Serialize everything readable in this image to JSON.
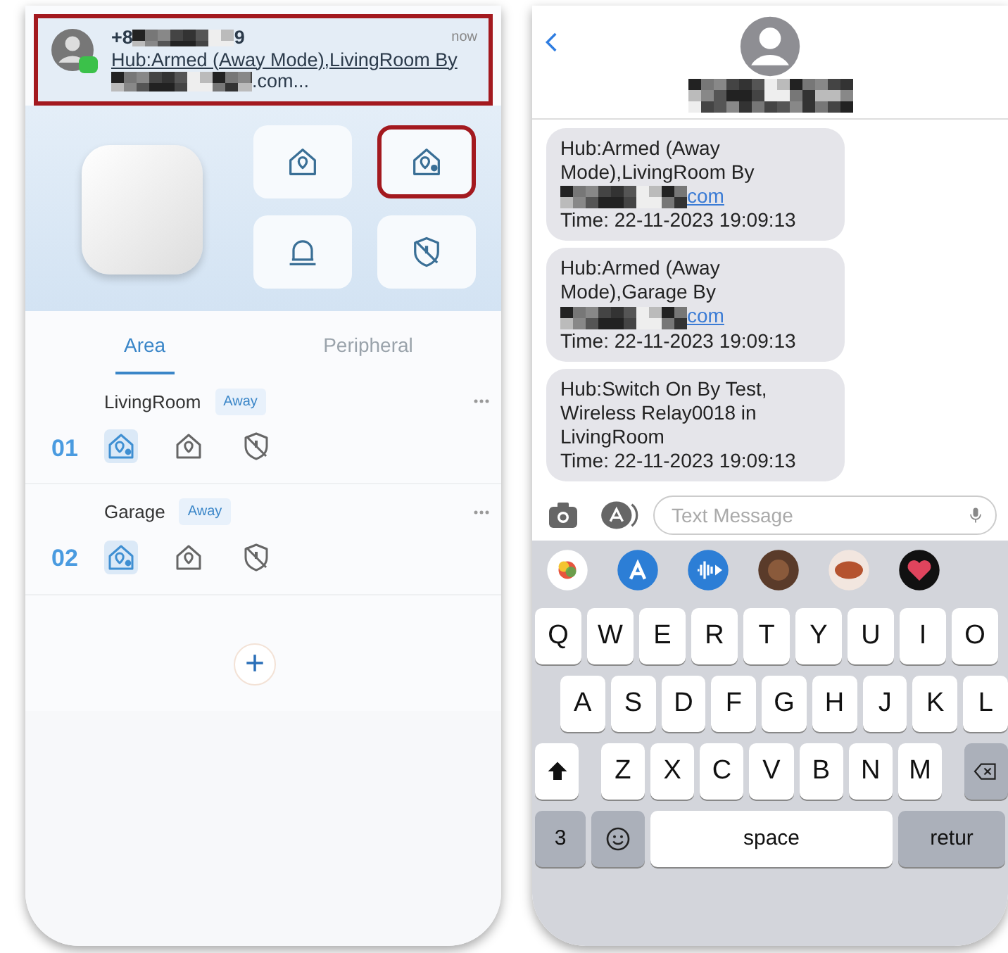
{
  "notification": {
    "sender_prefix": "+8",
    "sender_suffix": "9",
    "time": "now",
    "line_1": "Hub:Armed (Away Mode),LivingRoom By",
    "line_2_suffix": ".com...",
    "highlighted": true
  },
  "mode_buttons": [
    {
      "kind": "home",
      "highlighted": false
    },
    {
      "kind": "away",
      "highlighted": true
    },
    {
      "kind": "alarm",
      "highlighted": false
    },
    {
      "kind": "disarm",
      "highlighted": false
    }
  ],
  "tabs": [
    {
      "label": "Area",
      "selected": true
    },
    {
      "label": "Peripheral",
      "selected": false
    }
  ],
  "areas": [
    {
      "number": "01",
      "name": "LivingRoom",
      "badge": "Away",
      "modes": [
        {
          "kind": "away",
          "selected": true
        },
        {
          "kind": "home",
          "selected": false
        },
        {
          "kind": "disarm",
          "selected": false
        }
      ]
    },
    {
      "number": "02",
      "name": "Garage",
      "badge": "Away",
      "modes": [
        {
          "kind": "away",
          "selected": true
        },
        {
          "kind": "home",
          "selected": false
        },
        {
          "kind": "disarm",
          "selected": false
        }
      ]
    }
  ],
  "add_button": {
    "label": "+"
  },
  "messages": [
    {
      "text": "Hub:Armed (Away Mode),LivingRoom By",
      "link": "com",
      "time": "Time: 22-11-2023 19:09:13"
    },
    {
      "text": "Hub:Armed (Away Mode),Garage By",
      "link": "com",
      "time": "Time: 22-11-2023 19:09:13"
    },
    {
      "text": "Hub:Switch On By Test, Wireless Relay0018 in LivingRoom",
      "time": "Time: 22-11-2023 19:09:13"
    }
  ],
  "compose": {
    "placeholder": "Text Message"
  },
  "keyboard": {
    "rows": [
      [
        "Q",
        "W",
        "E",
        "R",
        "T",
        "Y",
        "U",
        "I",
        "O"
      ],
      [
        "A",
        "S",
        "D",
        "F",
        "G",
        "H",
        "J",
        "K",
        "L"
      ],
      [
        "Z",
        "X",
        "C",
        "V",
        "B",
        "N",
        "M"
      ]
    ],
    "bottom": [
      {
        "kind": "key",
        "label": "3"
      },
      {
        "kind": "emoji"
      },
      {
        "kind": "space",
        "label": "space"
      },
      {
        "kind": "return",
        "label": "retur"
      }
    ]
  }
}
